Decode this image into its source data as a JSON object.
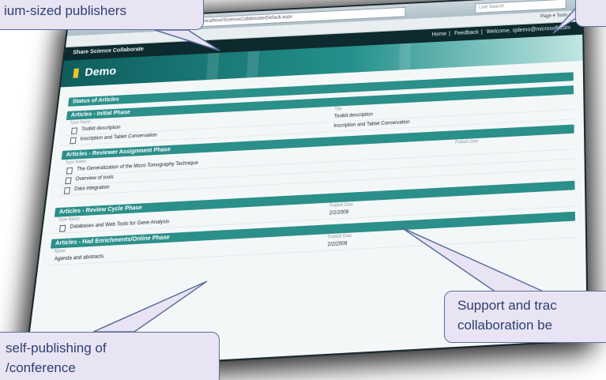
{
  "browser": {
    "address": "http://localhost/ScienceCollaborate/Default.aspx",
    "search_placeholder": "Live Search",
    "tools": "Page ▾  Tools ▾"
  },
  "site": {
    "brand": "Share Science Collaborate",
    "nav": [
      "Home",
      "Feedback",
      "Welcome, sjdemo@microsoft.com"
    ],
    "page_title": "Demo"
  },
  "sections": [
    {
      "heading": "Status of Articles",
      "sub": "",
      "colhead": "",
      "rows": []
    },
    {
      "heading": "Articles - Initial Phase",
      "sub": "Type  Name",
      "colhead": "Title",
      "rows": [
        {
          "name": "Toolkit description",
          "col2": "Toolkit description"
        },
        {
          "name": "Inscription and Tablet Conservation",
          "col2": "Inscription and Tablet Conservation"
        }
      ]
    },
    {
      "heading": "Articles - Reviewer Assignment Phase",
      "sub": "Type  Name",
      "colhead": "Publish Date",
      "rows": [
        {
          "name": "The Generalization of the Micro Tomography Technique",
          "col2": ""
        },
        {
          "name": "Overview of tools",
          "col2": ""
        },
        {
          "name": "Data integration",
          "col2": ""
        }
      ]
    },
    {
      "heading": "Articles - Review Cycle Phase",
      "sub": "Type  Name",
      "colhead": "Publish Date",
      "rows": [
        {
          "name": "Databases and Web Tools for Gene Analysis",
          "col2": "2/2/2009"
        }
      ]
    },
    {
      "heading": "Articles - Had Enrichments/Online Phase",
      "sub": "Name",
      "colhead": "Publish Date",
      "rows": [
        {
          "name": "Agenda and abstracts",
          "col2": "2/2/2009"
        }
      ]
    }
  ],
  "callouts": {
    "top_left": "ium-sized publishers",
    "bottom_left_line1": "self-publishing of",
    "bottom_left_line2": "/conference",
    "bottom_right_line1": "Support and trac",
    "bottom_right_line2": "collaboration be"
  },
  "colors": {
    "callout_fill": "#e8e4f4",
    "callout_border": "#5b6f9b",
    "callout_text": "#2e3f70",
    "accent": "#2b8f8a"
  }
}
